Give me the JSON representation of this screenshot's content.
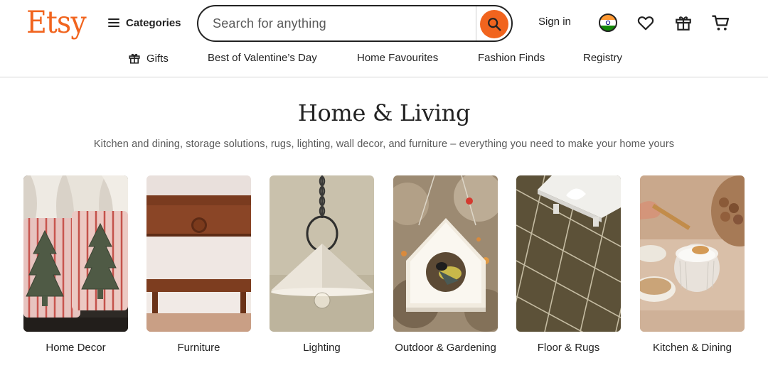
{
  "header": {
    "logo": "Etsy",
    "categories_label": "Categories",
    "search": {
      "placeholder": "Search for anything",
      "value": ""
    },
    "sign_in": "Sign in",
    "icons": [
      "india-flag-icon",
      "heart-icon",
      "gift-icon",
      "cart-icon"
    ]
  },
  "nav": {
    "items": [
      {
        "label": "Gifts",
        "icon": "gift-icon"
      },
      {
        "label": "Best of Valentine’s Day"
      },
      {
        "label": "Home Favourites"
      },
      {
        "label": "Fashion Finds"
      },
      {
        "label": "Registry"
      }
    ]
  },
  "main": {
    "title": "Home & Living",
    "subtitle": "Kitchen and dining, storage solutions, rugs, lighting, wall decor, and furniture – everything you need to make your home yours",
    "categories": [
      {
        "label": "Home Decor"
      },
      {
        "label": "Furniture"
      },
      {
        "label": "Lighting"
      },
      {
        "label": "Outdoor & Gardening"
      },
      {
        "label": "Floor & Rugs"
      },
      {
        "label": "Kitchen & Dining"
      }
    ]
  },
  "colors": {
    "brand": "#F1641E",
    "text": "#222222",
    "muted": "#595959",
    "divider": "#d6d6d6"
  }
}
